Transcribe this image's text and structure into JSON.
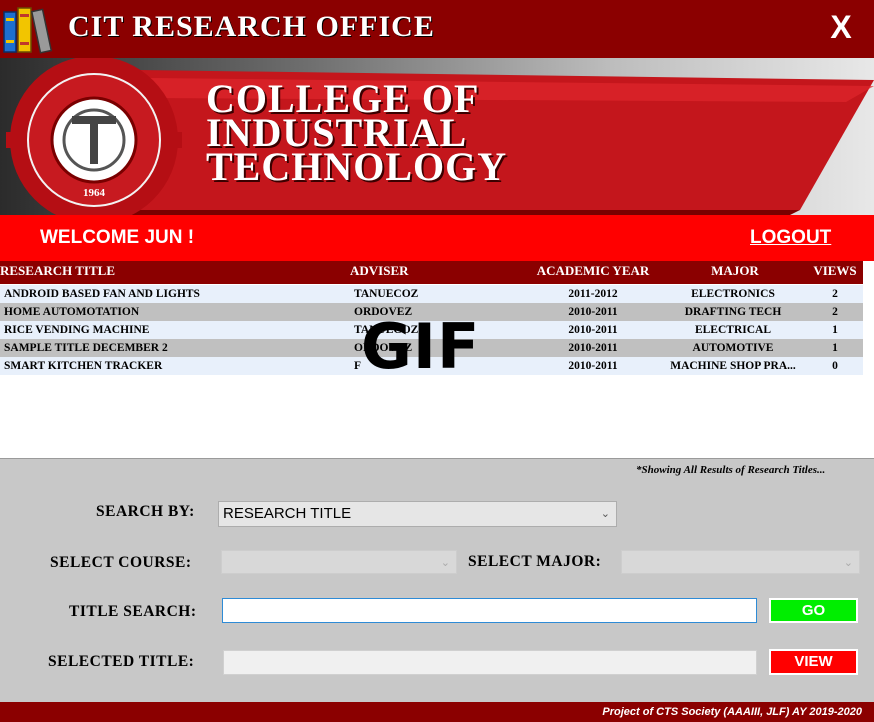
{
  "app": {
    "title": "CIT RESEARCH OFFICE",
    "close_label": "X"
  },
  "banner": {
    "line1": "COLLEGE OF",
    "line2": "INDUSTRIAL",
    "line3": "TECHNOLOGY",
    "seal_year": "1964",
    "seal_text": "COLLEGE OF INDUSTRIAL TECHNOLOGY"
  },
  "welcome": {
    "text": "WELCOME  JUN !",
    "logout_label": "LOGOUT"
  },
  "table": {
    "columns": [
      "RESEARCH TITLE",
      "ADVISER",
      "ACADEMIC YEAR",
      "MAJOR",
      "VIEWS"
    ],
    "rows": [
      [
        "ANDROID BASED FAN AND LIGHTS",
        "TANUECOZ",
        "2011-2012",
        "ELECTRONICS",
        "2"
      ],
      [
        "HOME AUTOMOTATION",
        "ORDOVEZ",
        "2010-2011",
        "DRAFTING TECH",
        "2"
      ],
      [
        "RICE VENDING MACHINE",
        "TANUECOZ",
        "2010-2011",
        "ELECTRICAL",
        "1"
      ],
      [
        "SAMPLE TITLE DECEMBER 2",
        "ORDOVEZ",
        "2010-2011",
        "AUTOMOTIVE",
        "1"
      ],
      [
        "SMART KITCHEN TRACKER",
        "F",
        "2010-2011",
        "MACHINE SHOP PRA...",
        "0"
      ]
    ]
  },
  "overlay": {
    "gif_label": "GIF"
  },
  "search": {
    "note": "*Showing All Results of Research Titles...",
    "search_by_label": "SEARCH BY:",
    "search_by_value": "RESEARCH TITLE",
    "course_label": "SELECT COURSE:",
    "course_value": "",
    "major_label": "SELECT MAJOR:",
    "major_value": "",
    "title_search_label": "TITLE SEARCH:",
    "title_search_value": "",
    "selected_title_label": "SELECTED TITLE:",
    "selected_title_value": "",
    "go_label": "GO",
    "view_label": "VIEW"
  },
  "footer": {
    "text": "Project of CTS Society (AAAIII, JLF) AY 2019-2020"
  },
  "colors": {
    "maroon": "#8b0000",
    "red": "#ff0000",
    "go_green": "#00ee00",
    "view_red": "#ff0000",
    "row_light": "#e8f0fb",
    "row_gray": "#c0c0c0"
  }
}
